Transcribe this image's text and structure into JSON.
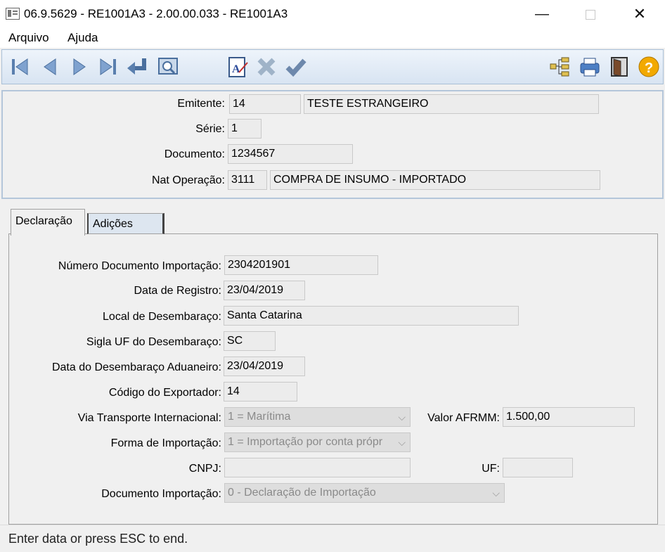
{
  "window": {
    "title": "06.9.5629 - RE1001A3 - 2.00.00.033 - RE1001A3",
    "minimize_glyph": "—",
    "close_glyph": "✕"
  },
  "menu": [
    "Arquivo",
    "Ajuda"
  ],
  "toolbar": {
    "icons": [
      "first-record-icon",
      "previous-record-icon",
      "next-record-icon",
      "last-record-icon",
      "goto-icon",
      "search-icon",
      "edit-icon",
      "cancel-icon",
      "confirm-icon",
      "tree-icon",
      "print-icon",
      "exit-icon",
      "help-icon"
    ]
  },
  "header": {
    "emitente_label": "Emitente:",
    "emitente_code": "14",
    "emitente_name": "TESTE ESTRANGEIRO",
    "serie_label": "Série:",
    "serie": "1",
    "documento_label": "Documento:",
    "documento": "1234567",
    "nat_label": "Nat Operação:",
    "nat_code": "3111",
    "nat_desc": "COMPRA DE INSUMO - IMPORTADO"
  },
  "tabs": [
    "Declaração",
    "Adições"
  ],
  "form": {
    "num_doc_label": "Número Documento Importação:",
    "num_doc": "2304201901",
    "data_registro_label": "Data de Registro:",
    "data_registro": "23/04/2019",
    "local_label": "Local de Desembaraço:",
    "local": "Santa Catarina",
    "sigla_label": "Sigla UF do Desembaraço:",
    "sigla": "SC",
    "data_desemb_label": "Data do Desembaraço Aduaneiro:",
    "data_desemb": "23/04/2019",
    "cod_export_label": "Código do Exportador:",
    "cod_export": "14",
    "via_label": "Via Transporte Internacional:",
    "via": "1 = Marítima",
    "afrmm_label": "Valor AFRMM:",
    "afrmm": "1.500,00",
    "forma_label": "Forma de Importação:",
    "forma": "1 = Importação por conta própr",
    "cnpj_label": "CNPJ:",
    "cnpj": "",
    "uf_label": "UF:",
    "uf": "",
    "doc_imp_label": "Documento Importação:",
    "doc_imp": "0 - Declaração de Importação"
  },
  "status": "Enter data or press ESC to end."
}
